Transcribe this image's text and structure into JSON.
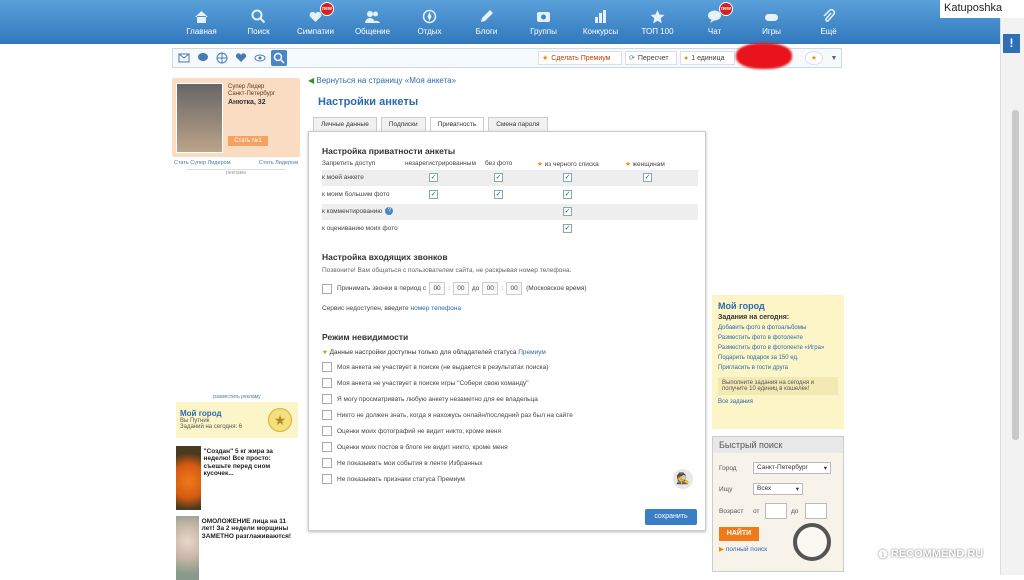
{
  "nav": [
    {
      "label": "Главная",
      "icon": "home-icon",
      "new": false
    },
    {
      "label": "Поиск",
      "icon": "search-icon",
      "new": false
    },
    {
      "label": "Симпатии",
      "icon": "hearts-icon",
      "new": true
    },
    {
      "label": "Общение",
      "icon": "people-icon",
      "new": false
    },
    {
      "label": "Отдых",
      "icon": "compass-icon",
      "new": false
    },
    {
      "label": "Блоги",
      "icon": "pen-icon",
      "new": false
    },
    {
      "label": "Группы",
      "icon": "groups-icon",
      "new": false
    },
    {
      "label": "Конкурсы",
      "icon": "bars-icon",
      "new": false
    },
    {
      "label": "ТОП 100",
      "icon": "star-icon",
      "new": false
    },
    {
      "label": "Чат",
      "icon": "chat-icon",
      "new": true
    },
    {
      "label": "Игры",
      "icon": "gamepad-icon",
      "new": false
    },
    {
      "label": "Ещё",
      "icon": "paperclip-icon",
      "new": false
    }
  ],
  "new_badge": "new",
  "watermark": "Katuposhka",
  "scroll_badge": "!",
  "toolbar": {
    "premium": "Сделать Премиум",
    "recount": "Пересчет",
    "units": "1 единица"
  },
  "left": {
    "leader_label": "Супер Лидер",
    "city": "Санкт-Петербург",
    "name": "Анютка, 32",
    "become": "Стать №1",
    "link1": "Стать Супер Лидером",
    "link2": "Стать Лидером",
    "ad_label": "реклама",
    "place_ad": "разместить рекламу",
    "city_title": "Мой город",
    "city_status": "Вы Путник",
    "city_tasks": "Заданий на сегодня: 6",
    "ad1": "\"Создан\" 5 кг жира за неделю! Все просто: съешьте перед сном кусочек...",
    "ad2": "ОМОЛОЖЕНИЕ лица на 11 лет! За 2 недели морщины ЗАМЕТНО разглаживаются!"
  },
  "main": {
    "back": "Вернуться на страницу «Моя анкета»",
    "title": "Настройки анкеты",
    "tabs": [
      "Личные данные",
      "Подписки",
      "Приватность",
      "Смена пароля"
    ],
    "active_tab": "Приватность",
    "privacy_title": "Настройка приватности анкеты",
    "forbid": "Запретить доступ",
    "cols": [
      "незарегистрированным",
      "без фото",
      "из черного списка",
      "женщинам"
    ],
    "rows": [
      {
        "label": "к моей анкете",
        "checks": [
          true,
          true,
          true,
          true
        ]
      },
      {
        "label": "к моим большим фото",
        "checks": [
          true,
          true,
          true,
          false
        ]
      },
      {
        "label": "к комментированию",
        "checks": [
          false,
          false,
          true,
          false
        ]
      },
      {
        "label": "к оцениванию моих фото",
        "checks": [
          false,
          false,
          true,
          false
        ]
      }
    ],
    "calls_title": "Настройка входящих звонков",
    "calls_note": "Позвоните! Вам общаться с пользователем сайта, не раскрывая номер телефона.",
    "calls_period": "Принимать звонки в период с",
    "t1": "00",
    "t2": "00",
    "t3": "00",
    "t4": "00",
    "to": "до",
    "moscow": "(Московское время)",
    "service": "Сервис недоступен, введите",
    "phone_link": "номер телефона",
    "invis_title": "Режим невидимости",
    "invis_note": "Данные настройки доступны только для обладателей статуса",
    "premium_link": "Премиум",
    "invis": [
      "Моя анкета не участвует в поиске (не выдается в результатах поиска)",
      "Моя анкета не участвует в поиске игры \"Собери свою команду\"",
      "Я могу просматривать любую анкету незаметно для ее владельца",
      "Никто не должен знать, когда я нахожусь онлайн/последний раз был на сайте",
      "Оценки моих фотографий не видит никто, кроме меня",
      "Оценки моих постов в блоге не видит никто, кроме меня",
      "Не показывать мои события в ленте Избранных",
      "Не показывать признаки статуса Премиум"
    ],
    "save": "сохранить"
  },
  "right": {
    "title": "Мой город",
    "tasks_title": "Задания на сегодня:",
    "tasks": [
      "Добавить фото в фотоальбомы",
      "Разместить фото в фотоленте",
      "Разместить фото в фотоленте «Игра»",
      "Подарить подарок за 150 ед.",
      "Пригласить в гости друга"
    ],
    "box": "Выполните задания на сегодня и получите 10 единиц в кошелек!",
    "all": "Все задания"
  },
  "quick": {
    "title": "Быстрый поиск",
    "city_label": "Город",
    "city": "Санкт-Петербург",
    "seek_label": "Ищу",
    "seek": "Всех",
    "age_label": "Возраст",
    "from": "от",
    "to": "до",
    "find": "НАЙТИ",
    "full": "полный поиск"
  },
  "recommend": "RECOMMEND.RU"
}
